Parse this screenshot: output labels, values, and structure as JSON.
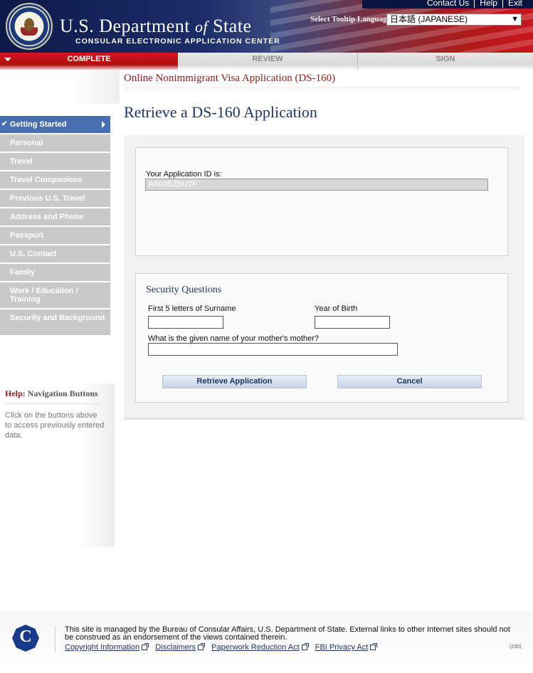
{
  "header": {
    "top_links": [
      "Contact Us",
      "Help",
      "Exit"
    ],
    "dept_title_main": "U.S. Department",
    "dept_title_of": "of",
    "dept_title_end": "State",
    "dept_subtitle": "CONSULAR ELECTRONIC APPLICATION CENTER",
    "tooltip_label": "Select Tooltip Language",
    "tooltip_value": "日本語 (JAPANESE)"
  },
  "tabs": {
    "complete": "COMPLETE",
    "review": "REVIEW",
    "sign": "SIGN"
  },
  "sidebar": {
    "items": [
      "Getting Started",
      "Personal",
      "Travel",
      "Travel Companions",
      "Previous U.S. Travel",
      "Address and Phone",
      "Passport",
      "U.S. Contact",
      "Family",
      "Work / Education / Training",
      "Security and Background"
    ],
    "help_prefix": "Help:",
    "help_title": "Navigation Buttons",
    "help_text": "Click on the buttons above to access previously entered data."
  },
  "main": {
    "app_title": "Online Nonimmigrant Visa Application (DS-160)",
    "page_title": "Retrieve a DS-160 Application",
    "app_id_label": "Your Application ID is:",
    "app_id_value": "AA00EZBU7F",
    "security_title": "Security Questions",
    "surname_label": "First 5 letters of Surname",
    "surname_value": "",
    "year_label": "Year of Birth",
    "year_value": "",
    "mother_label": "What is the given name of your mother's mother?",
    "mother_value": "",
    "retrieve_button": "Retrieve Application",
    "cancel_button": "Cancel"
  },
  "footer": {
    "text": "This site is managed by the Bureau of Consular Affairs, U.S. Department of State. External links to other Internet sites should not be construed as an endorsement of the views contained therein.",
    "links": [
      "Copyright Information",
      "Disclaimers",
      "Paperwork Reduction Act",
      "FBI Privacy Act"
    ],
    "page_number": "(235)"
  }
}
